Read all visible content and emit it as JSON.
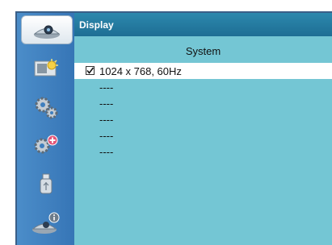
{
  "sidebar": {
    "items": [
      {
        "icon": "display-icon",
        "active": true
      },
      {
        "icon": "image-adjust-icon",
        "active": false
      },
      {
        "icon": "settings-gear-icon",
        "active": false
      },
      {
        "icon": "extended-settings-icon",
        "active": false
      },
      {
        "icon": "usb-memory-icon",
        "active": false
      },
      {
        "icon": "information-icon",
        "active": false
      }
    ]
  },
  "header": {
    "title": "Display"
  },
  "panel": {
    "column_title": "System",
    "rows": [
      {
        "label": "1024 x 768, 60Hz",
        "checked": true
      },
      {
        "label": "----"
      },
      {
        "label": "----"
      },
      {
        "label": "----"
      },
      {
        "label": "----"
      },
      {
        "label": "----"
      }
    ]
  },
  "colors": {
    "content_bg": "#74c6d4",
    "sidebar_bg": "#3f7fbe",
    "header_bg": "#1e6e94",
    "selected_row": "#ffffff"
  }
}
